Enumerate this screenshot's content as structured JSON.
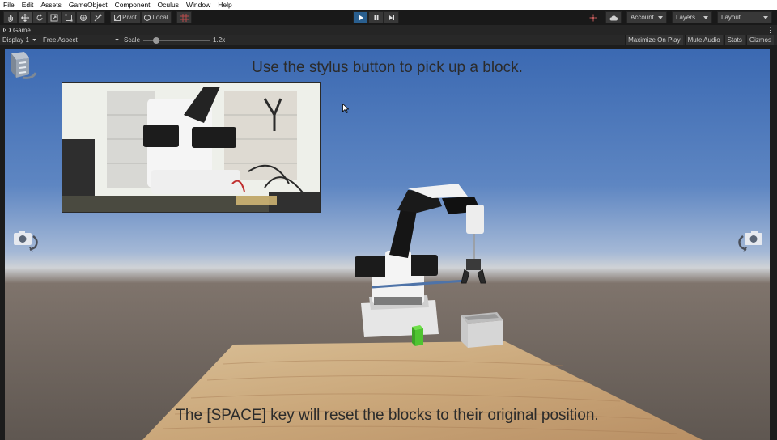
{
  "menu": {
    "items": [
      "File",
      "Edit",
      "Assets",
      "GameObject",
      "Component",
      "Oculus",
      "Window",
      "Help"
    ]
  },
  "toolbar": {
    "tools": [
      "hand-icon",
      "move-icon",
      "rotate-icon",
      "scale-icon",
      "rect-icon",
      "transform-icon",
      "custom-tool-icon"
    ],
    "pivot_label": "Pivot",
    "local_label": "Local",
    "account_label": "Account",
    "layers_label": "Layers",
    "layout_label": "Layout"
  },
  "game_tab": {
    "title": "Game"
  },
  "game_bar": {
    "display": "Display 1",
    "aspect": "Free Aspect",
    "scale_label": "Scale",
    "scale_value": "1.2x",
    "maximize_label": "Maximize On Play",
    "mute_label": "Mute Audio",
    "stats_label": "Stats",
    "gizmos_label": "Gizmos"
  },
  "scene": {
    "instruction_top": "Use the stylus button to pick up a block.",
    "instruction_bottom": "The [SPACE] key will reset the blocks to their original position."
  },
  "colors": {
    "play_active": "#2a5f8f",
    "block_green": "#4fc431",
    "sky_top": "#3b69b2"
  }
}
